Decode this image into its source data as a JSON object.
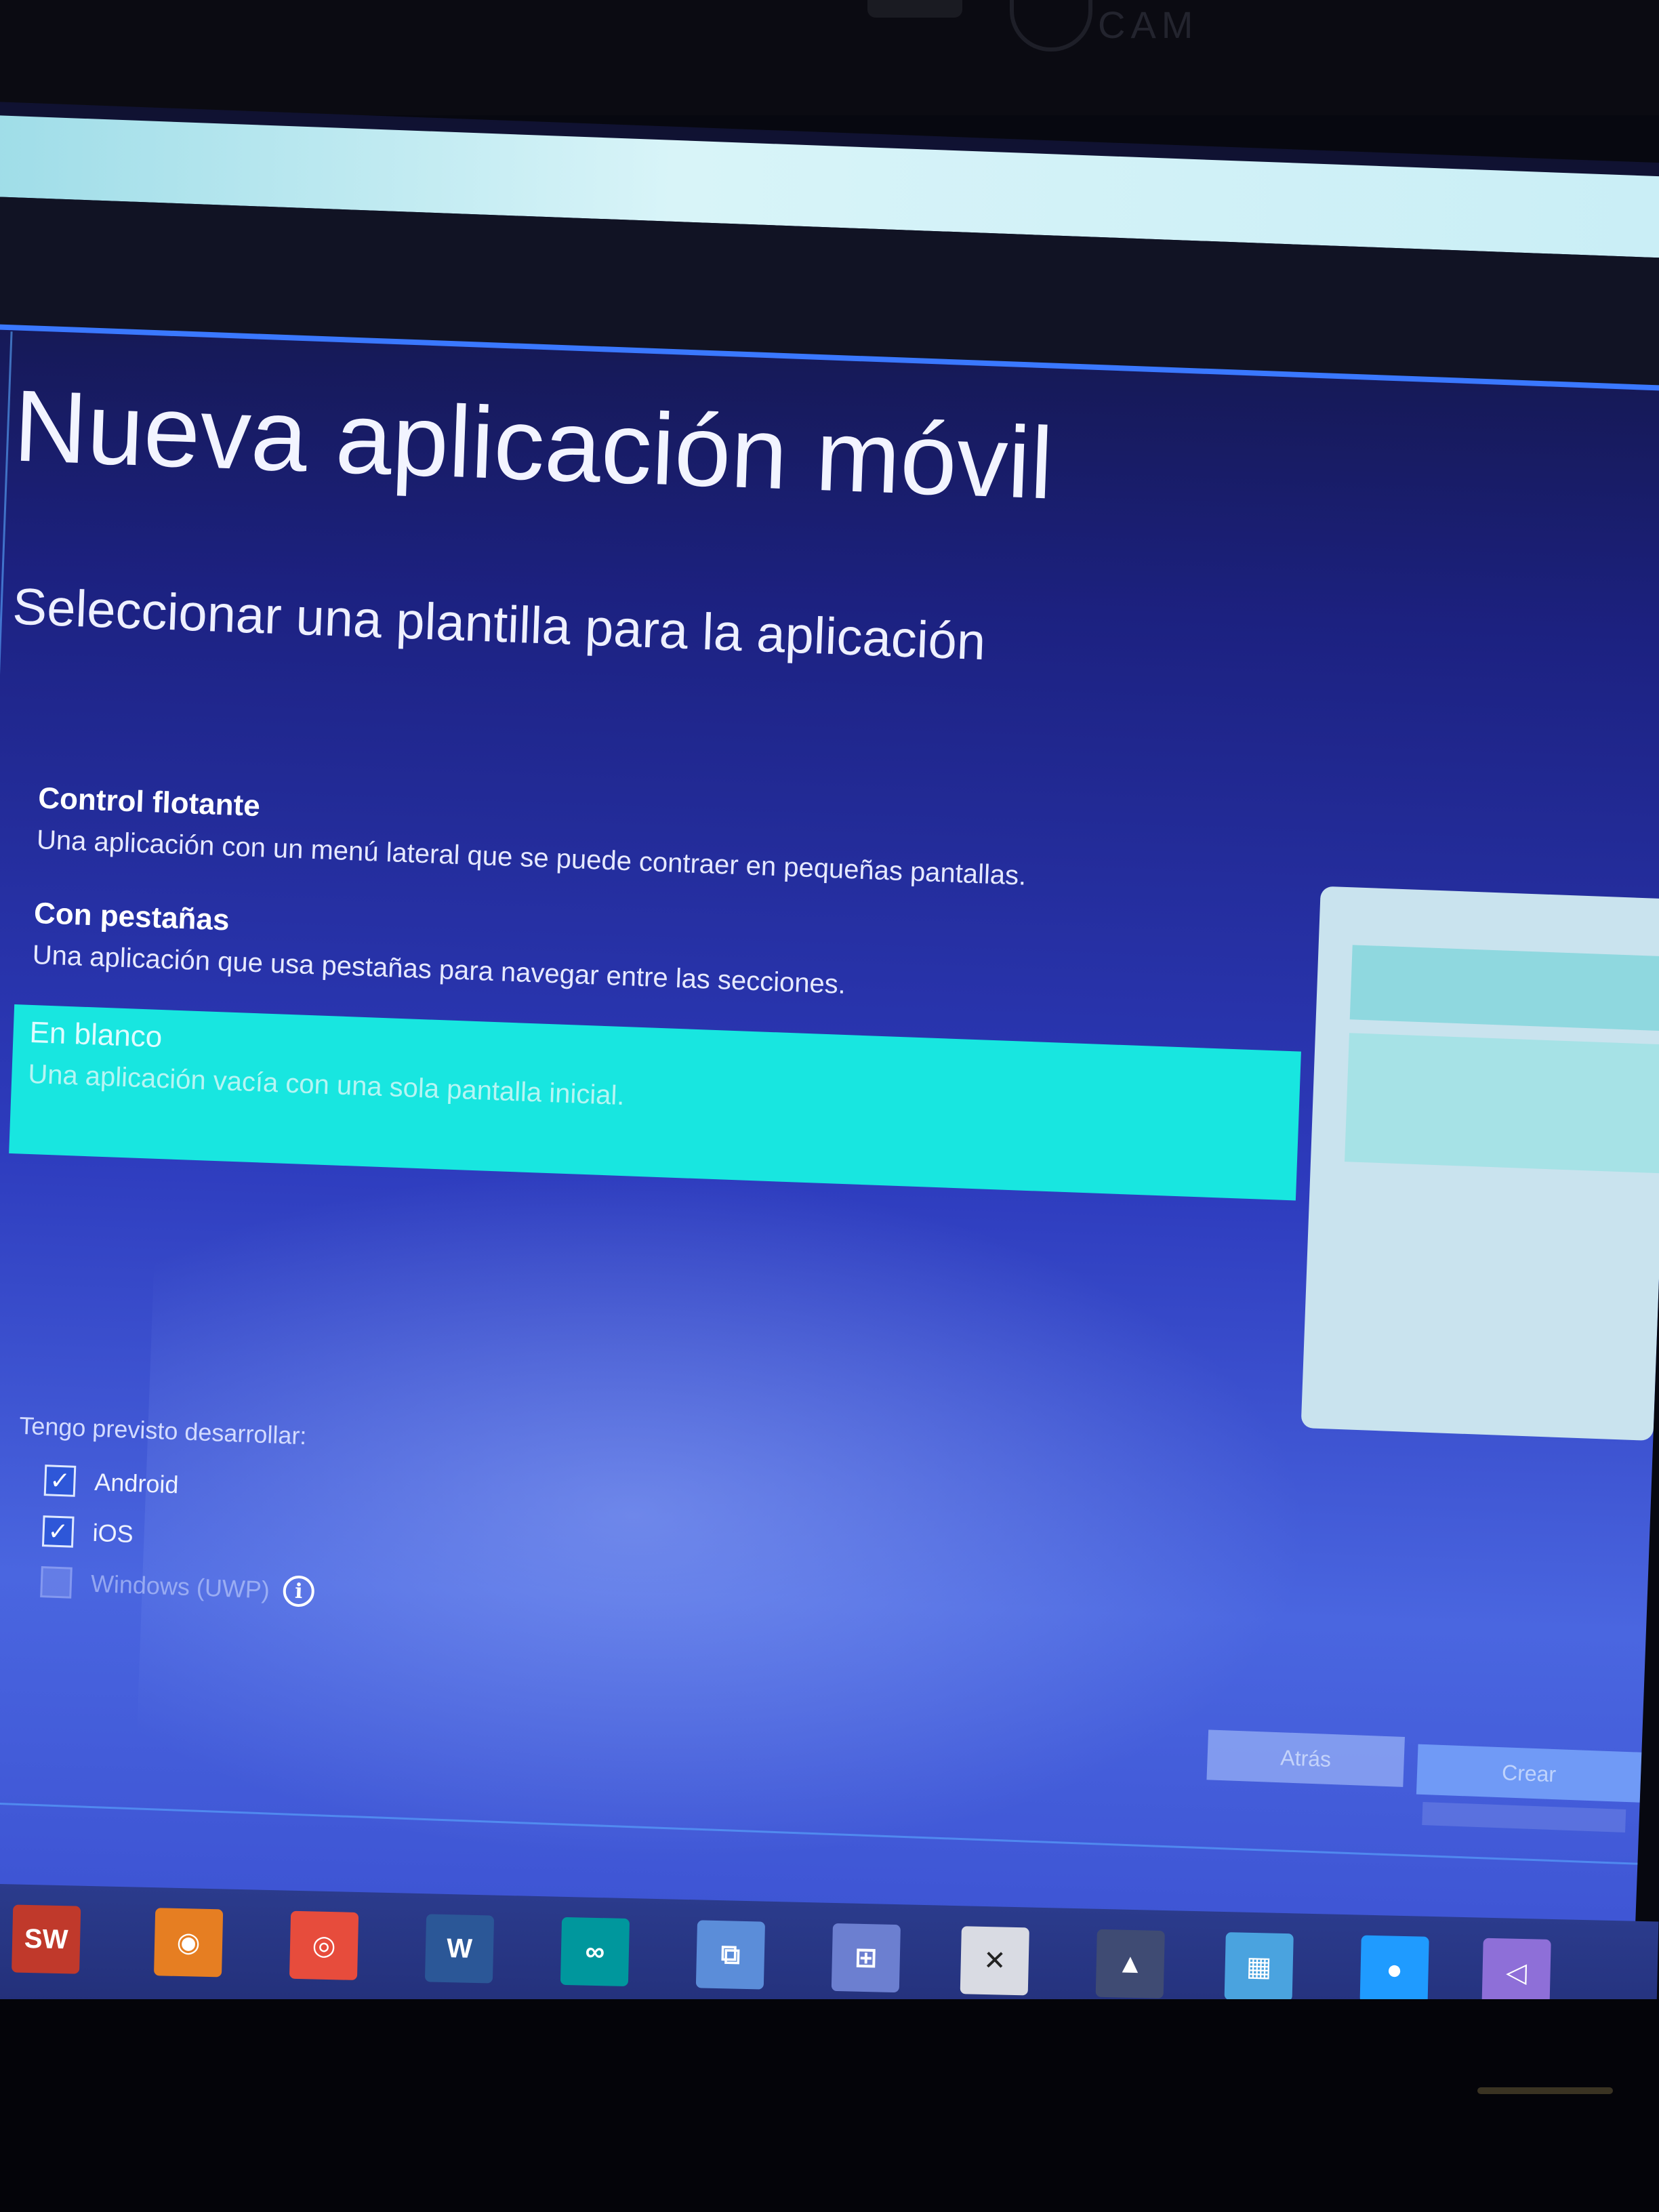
{
  "bezel": {
    "webcam_label": "CAM"
  },
  "dialog": {
    "title": "Nueva aplicación móvil",
    "subtitle": "Seleccionar una plantilla para la aplicación"
  },
  "templates": [
    {
      "name": "Control flotante",
      "description": "Una aplicación con un menú lateral que se puede contraer en pequeñas pantallas.",
      "selected": false
    },
    {
      "name": "Con pestañas",
      "description": "Una aplicación que usa pestañas para navegar entre las secciones.",
      "selected": false
    },
    {
      "name": "En blanco",
      "description": "Una aplicación vacía con una sola pantalla inicial.",
      "selected": true
    }
  ],
  "platforms": {
    "label": "Tengo previsto desarrollar:",
    "options": [
      {
        "name": "Android",
        "checked": true,
        "enabled": true
      },
      {
        "name": "iOS",
        "checked": true,
        "enabled": true
      },
      {
        "name": "Windows (UWP)",
        "checked": false,
        "enabled": false
      }
    ],
    "info_glyph": "i"
  },
  "buttons": {
    "back": "Atrás",
    "create": "Crear"
  },
  "taskbar": {
    "icons": [
      {
        "name": "solidworks-icon",
        "glyph": "SW",
        "color": "#c0392b"
      },
      {
        "name": "blender-icon",
        "glyph": "◉",
        "color": "#e67e22"
      },
      {
        "name": "chrome-icon",
        "glyph": "◎",
        "color": "#e74c3c"
      },
      {
        "name": "word-icon",
        "glyph": "W",
        "color": "#2b5797"
      },
      {
        "name": "arduino-icon",
        "glyph": "∞",
        "color": "#00979d"
      },
      {
        "name": "network-icon",
        "glyph": "⧉",
        "color": "#5b8dd9"
      },
      {
        "name": "remote-desktop-icon",
        "glyph": "⊞",
        "color": "#6c7fd0"
      },
      {
        "name": "close-window-icon",
        "glyph": "✕",
        "color": "#d9dbe3"
      },
      {
        "name": "photos-icon",
        "glyph": "▲",
        "color": "#3f4b73"
      },
      {
        "name": "windows-store-icon",
        "glyph": "▦",
        "color": "#4aa3df"
      },
      {
        "name": "firefox-icon",
        "glyph": "●",
        "color": "#1f9bff"
      },
      {
        "name": "visual-studio-icon",
        "glyph": "◁",
        "color": "#8e6fd8"
      }
    ]
  },
  "colors": {
    "selected_template": "#18e6e0",
    "accent_line": "#3a78ff"
  }
}
